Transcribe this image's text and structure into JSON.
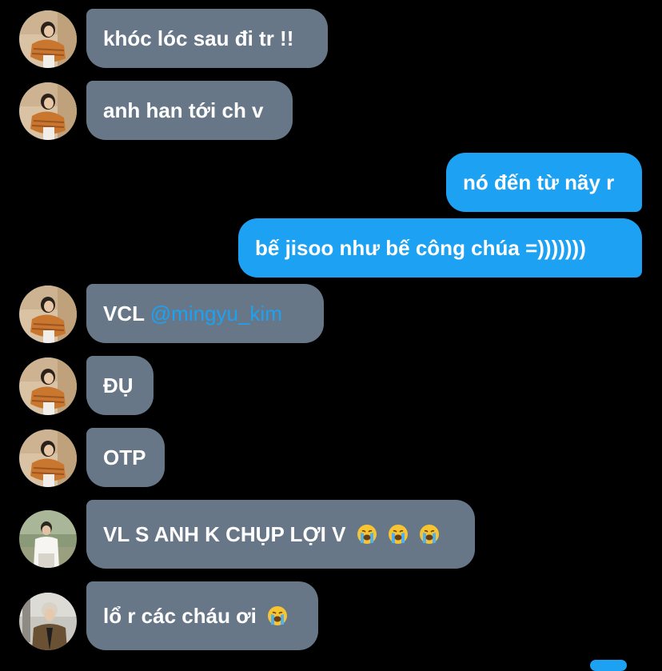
{
  "colors": {
    "background": "#000000",
    "incoming_bubble": "#677788",
    "outgoing_bubble": "#1da1f2",
    "mention": "#1da1f2"
  },
  "messages": [
    {
      "direction": "incoming",
      "avatar": "avatar-girl-photo",
      "text": "khóc lóc sau đi tr !!"
    },
    {
      "direction": "incoming",
      "avatar": "avatar-girl-photo",
      "text": "anh han tới ch v"
    },
    {
      "direction": "outgoing",
      "text": "nó đến từ nãy r"
    },
    {
      "direction": "outgoing",
      "text": "bế jisoo như bế công chúa =)))))))"
    },
    {
      "direction": "incoming",
      "avatar": "avatar-girl-photo",
      "text": "VCL ",
      "mention": "@mingyu_kim"
    },
    {
      "direction": "incoming",
      "avatar": "avatar-girl-photo",
      "text": "ĐỤ"
    },
    {
      "direction": "incoming",
      "avatar": "avatar-girl-photo",
      "text": "OTP"
    },
    {
      "direction": "incoming",
      "avatar": "avatar-man-white-shirt",
      "text": "VL S ANH K CHỤP LỢI V",
      "emojis": [
        "loudly-crying-face",
        "loudly-crying-face",
        "loudly-crying-face"
      ]
    },
    {
      "direction": "incoming",
      "avatar": "avatar-man-brown-coat",
      "text": "lổ r các cháu ơi",
      "emojis": [
        "loudly-crying-face"
      ]
    }
  ]
}
